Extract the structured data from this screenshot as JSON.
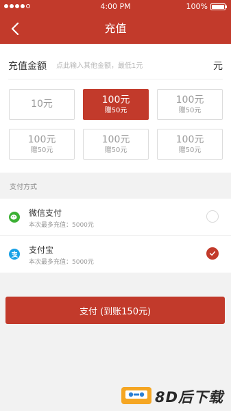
{
  "status_bar": {
    "time": "4:00 PM",
    "battery": "100%",
    "battery_level": 1.0
  },
  "nav": {
    "title": "充值",
    "back_icon": "chevron-left-icon"
  },
  "amount": {
    "label": "充值金额",
    "placeholder": "点此输入其他金额，最低1元",
    "value": "",
    "unit": "元"
  },
  "options": [
    {
      "main": "10元",
      "sub": "",
      "selected": false
    },
    {
      "main": "100元",
      "sub": "赠50元",
      "selected": true
    },
    {
      "main": "100元",
      "sub": "赠50元",
      "selected": false
    },
    {
      "main": "100元",
      "sub": "赠50元",
      "selected": false
    },
    {
      "main": "100元",
      "sub": "赠50元",
      "selected": false
    },
    {
      "main": "100元",
      "sub": "赠50元",
      "selected": false
    }
  ],
  "payment": {
    "section_title": "支付方式",
    "methods": [
      {
        "name": "微信支付",
        "note": "本次最多充值：5000元",
        "icon": "wechat-pay-icon",
        "icon_color": "#3cb034",
        "checked": false
      },
      {
        "name": "支付宝",
        "note": "本次最多充值：5000元",
        "icon": "alipay-icon",
        "icon_color": "#1aa1e6",
        "checked": true
      }
    ]
  },
  "pay_button": {
    "label": "支付 (到账150元)"
  },
  "watermark": {
    "text": "8D后下载"
  },
  "colors": {
    "accent": "#c23a2b",
    "background": "#f2f2f2"
  }
}
